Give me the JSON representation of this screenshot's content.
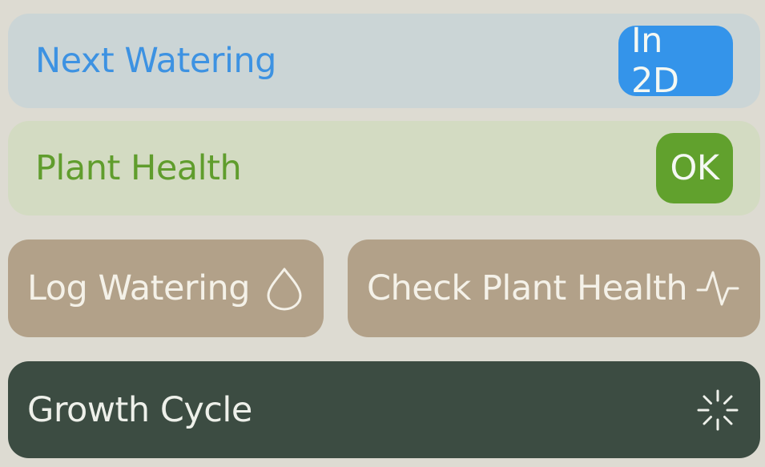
{
  "watering": {
    "label": "Next Watering",
    "badge": "In 2D",
    "accent_color": "#3494ea"
  },
  "health": {
    "label": "Plant Health",
    "badge": "OK",
    "accent_color": "#61a12d"
  },
  "actions": [
    {
      "label": "Log Watering",
      "icon": "water-drop-icon"
    },
    {
      "label": "Check Plant Health",
      "icon": "pulse-icon"
    }
  ],
  "growth": {
    "label": "Growth Cycle",
    "icon": "loading-spinner-icon"
  }
}
